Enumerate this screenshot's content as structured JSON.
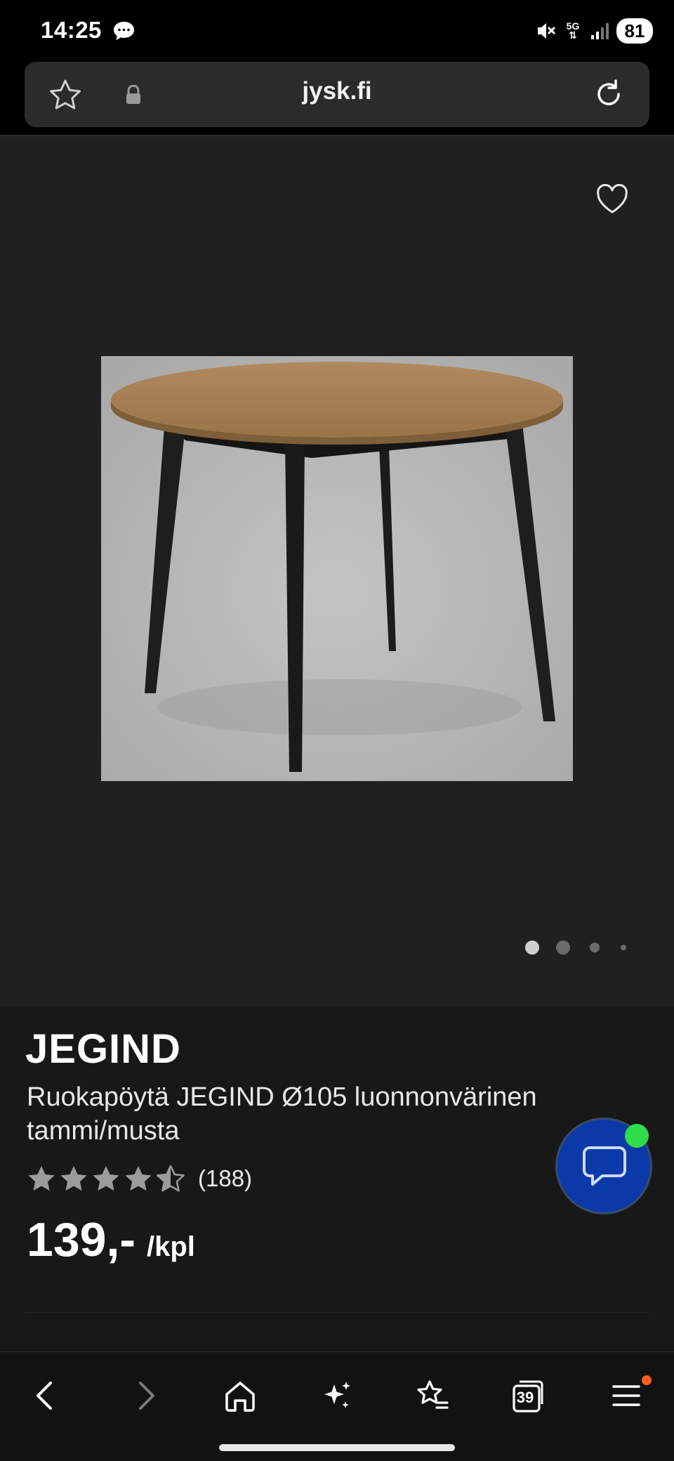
{
  "status_bar": {
    "time": "14:25",
    "network": "5G",
    "battery": "81"
  },
  "browser": {
    "url": "jysk.fi",
    "tabs_count": "39"
  },
  "product": {
    "brand": "JEGIND",
    "title": "Ruokapöytä JEGIND Ø105 luonnonvärinen tammi/musta",
    "rating": 4.5,
    "review_count": "(188)",
    "price": "139,-",
    "unit": "/kpl",
    "image_count": 4,
    "active_image": 1
  },
  "colors": {
    "chat_button": "#0b3aa8",
    "online_indicator": "#2fdc4a",
    "menu_badge": "#ff5a1f"
  },
  "icons": {
    "status_chat": "message-bubble-icon",
    "wishlist": "heart-icon",
    "bookmark": "star-icon",
    "lock": "lock-icon",
    "reload": "reload-icon",
    "chat": "chat-icon",
    "back": "back-arrow-icon",
    "forward": "forward-arrow-icon",
    "home": "home-icon",
    "ai": "sparkle-icon",
    "favorites": "favorites-list-icon",
    "tabs": "tabs-icon",
    "menu": "hamburger-menu-icon"
  }
}
